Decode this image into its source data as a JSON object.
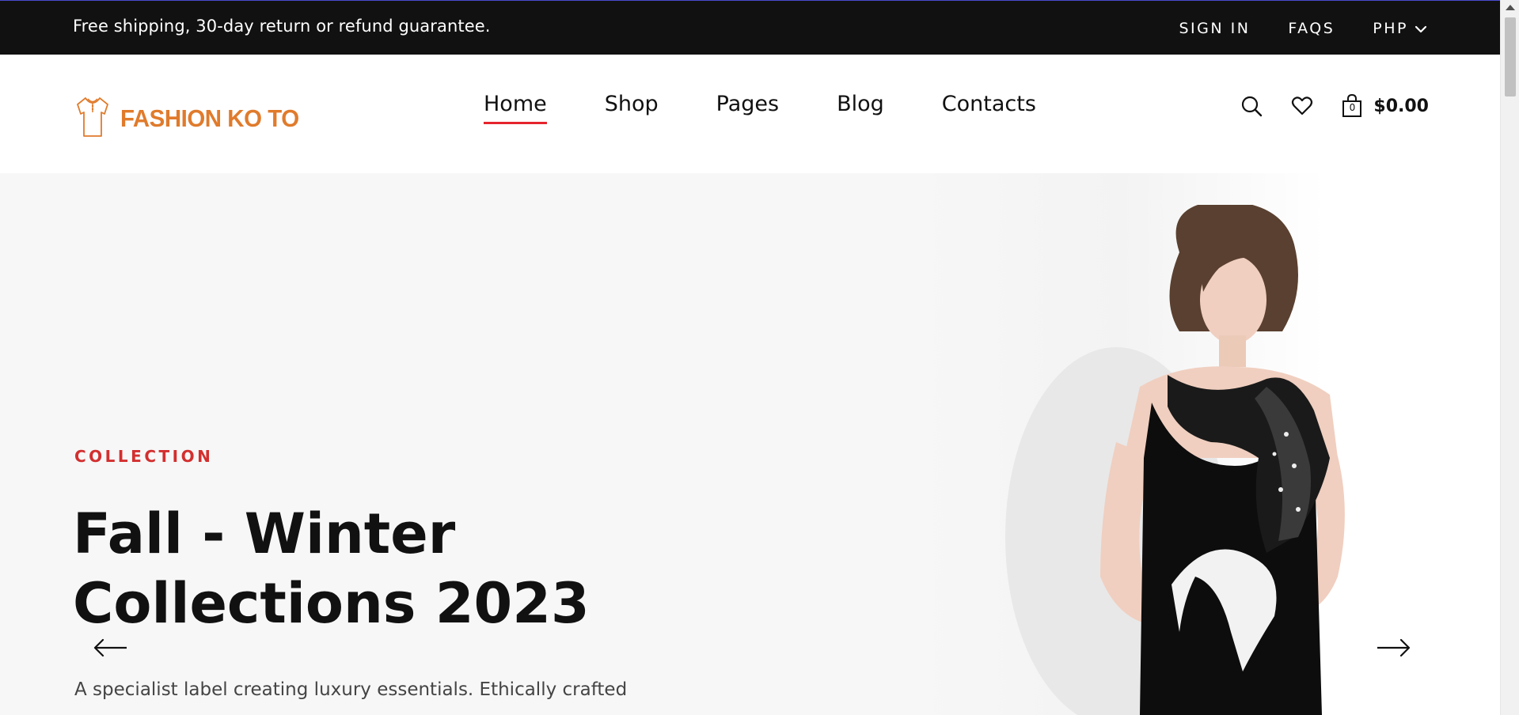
{
  "topbar": {
    "promo": "Free shipping, 30-day return or refund guarantee.",
    "sign_in": "SIGN IN",
    "faqs": "FAQS",
    "currency": "PHP"
  },
  "header": {
    "brand": "FASHION KO TO",
    "nav": [
      {
        "label": "Home",
        "active": true
      },
      {
        "label": "Shop"
      },
      {
        "label": "Pages"
      },
      {
        "label": "Blog"
      },
      {
        "label": "Contacts"
      }
    ],
    "cart": {
      "count": "0",
      "total": "$0.00"
    }
  },
  "hero": {
    "eyebrow": "COLLECTION",
    "headline_line1": "Fall - Winter",
    "headline_line2": "Collections 2023",
    "description": "A specialist label creating luxury essentials. Ethically crafted"
  },
  "colors": {
    "accent": "#e5242c",
    "brand": "#e07b2c",
    "topbar_bg": "#111111",
    "hero_bg": "#f7f7f7"
  },
  "icons": [
    "tshirt-logo-icon",
    "chevron-down-icon",
    "search-icon",
    "heart-icon",
    "shopping-bag-icon",
    "arrow-left-icon",
    "arrow-right-icon"
  ]
}
